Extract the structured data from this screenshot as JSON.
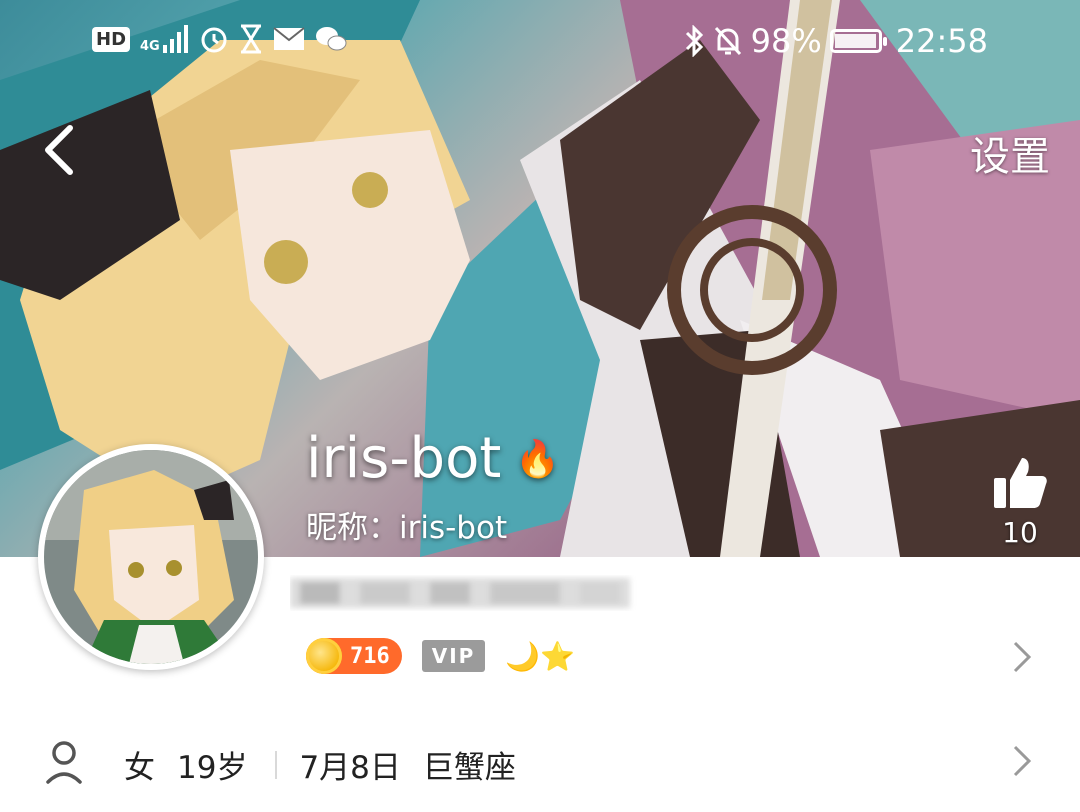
{
  "status_bar": {
    "left_badge": "HD",
    "network": "4G",
    "battery": "98%",
    "battery_fraction": 0.98,
    "time": "22:58",
    "icons": [
      "signal-icon",
      "alarm-icon",
      "hourglass-icon",
      "mail-icon",
      "wechat-icon",
      "bluetooth-icon",
      "mute-icon",
      "battery-icon"
    ]
  },
  "nav": {
    "back_icon": "chevron-left-icon",
    "settings_label": "设置"
  },
  "profile": {
    "username": "iris-bot",
    "flame_icon": "🔥",
    "nickname": "昵称：iris-bot",
    "likes": "10",
    "coins": "716",
    "vip_label": "VIP",
    "level_icons": "🌙⭐"
  },
  "info": {
    "gender": "女",
    "age": "19岁",
    "birthday": "7月8日",
    "zodiac": "巨蟹座"
  },
  "colors": {
    "coin_badge": "#ff6a2b",
    "vip_badge": "#9b9b9b",
    "text_primary": "#222222"
  }
}
